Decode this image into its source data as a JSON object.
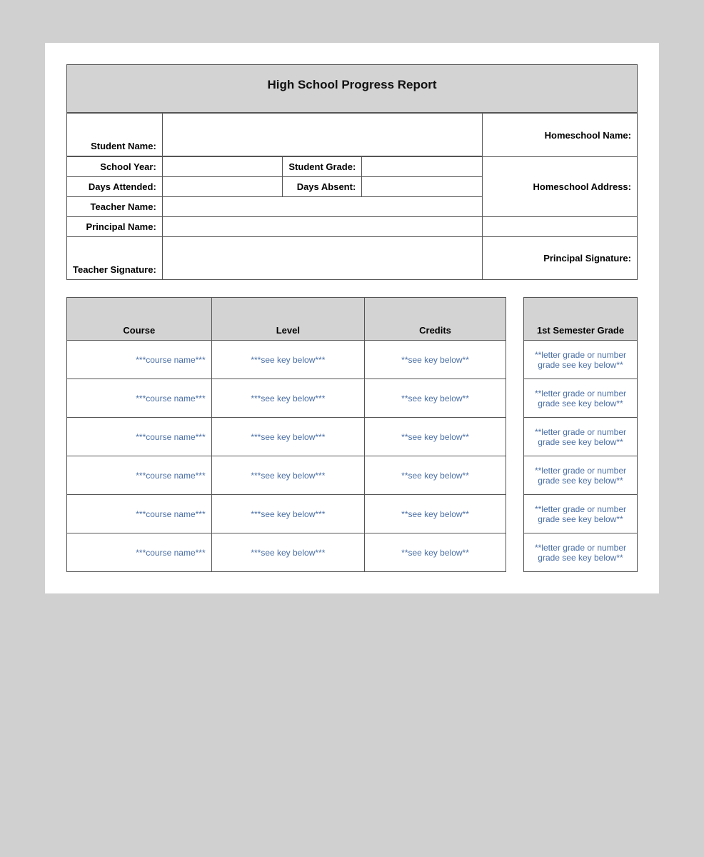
{
  "report": {
    "title": "High School Progress Report",
    "fields": {
      "student_name_label": "Student Name:",
      "homeschool_name_label": "Homeschool Name:",
      "school_year_label": "School Year:",
      "student_grade_label": "Student Grade:",
      "days_attended_label": "Days Attended:",
      "days_absent_label": "Days Absent:",
      "homeschool_address_label": "Homeschool Address:",
      "teacher_name_label": "Teacher Name:",
      "principal_name_label": "Principal Name:",
      "teacher_signature_label": "Teacher Signature:",
      "principal_signature_label": "Principal Signature:"
    }
  },
  "course_table": {
    "headers": {
      "course": "Course",
      "level": "Level",
      "credits": "Credits"
    },
    "rows": [
      {
        "course": "***course name***",
        "level": "***see key below***",
        "credits": "**see key below**"
      },
      {
        "course": "***course name***",
        "level": "***see key below***",
        "credits": "**see key below**"
      },
      {
        "course": "***course name***",
        "level": "***see key below***",
        "credits": "**see key below**"
      },
      {
        "course": "***course name***",
        "level": "***see key below***",
        "credits": "**see key below**"
      },
      {
        "course": "***course name***",
        "level": "***see key below***",
        "credits": "**see key below**"
      },
      {
        "course": "***course name***",
        "level": "***see key below***",
        "credits": "**see key below**"
      }
    ]
  },
  "grade_table": {
    "header": "1st Semester Grade",
    "rows": [
      "**letter grade or number grade see key below**",
      "**letter grade or number grade see key below**",
      "**letter grade or number grade see key below**",
      "**letter grade or number grade see key below**",
      "**letter grade or number grade see key below**",
      "**letter grade or number grade see key below**"
    ]
  }
}
